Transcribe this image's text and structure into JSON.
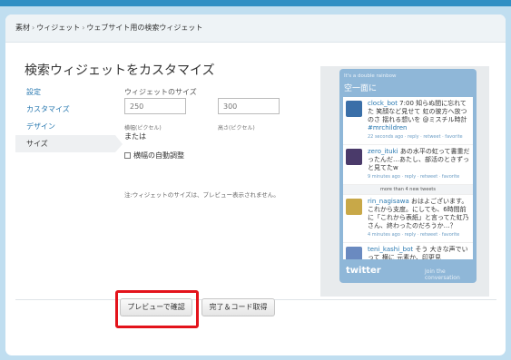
{
  "breadcrumb": [
    "素材",
    "ウィジェット",
    "ウェブサイト用の検索ウィジェット"
  ],
  "page_title": "検索ウィジェットをカスタマイズ",
  "nav": [
    {
      "label": "設定",
      "active": false
    },
    {
      "label": "カスタマイズ",
      "active": false
    },
    {
      "label": "デザイン",
      "active": false
    },
    {
      "label": "サイズ",
      "active": true
    }
  ],
  "form": {
    "size_label": "ウィジェットのサイズ",
    "width_placeholder": "250",
    "height_placeholder": "300",
    "width_hint": "横幅(ピクセル)",
    "height_hint": "高さ(ピクセル)",
    "or_label": "または",
    "auto_width_label": "横幅の自動調整",
    "note": "注:ウィジェットのサイズは、プレビュー表示されません。"
  },
  "widget": {
    "subtitle": "It's a double rainbow",
    "title": "空一面に",
    "tweets": [
      {
        "user": "clock_bot",
        "text_before": " 7:00 知らぬ間に忘れてた 笑顔など見せて 虹の彼方へ放つのさ 揺れる想いを @ミスチル時計 ",
        "link": "#mrchildren",
        "meta": "22 seconds ago · reply · retweet · favorite",
        "avatar_color": "#3a6fa8"
      },
      {
        "user": "zero_ituki",
        "text_before": " あの水平の虹って書重だったんだ…あたし、部活のときずっと見てたw",
        "link": "",
        "meta": "9 minutes ago · reply · retweet · favorite",
        "avatar_color": "#4a3a6a"
      },
      {
        "user": "rin_nagisawa",
        "text_before": " おはよございます。これから支度。にしても、6時間前に「これから表紙」と言ってた虹乃さん、終わったのだろうか…？",
        "link": "",
        "meta": "4 minutes ago · reply · retweet · favorite",
        "avatar_color": "#c8a848"
      },
      {
        "user": "teni_kashi_bot",
        "text_before": " そう 大きな声でいって 横に 元素か、印更見",
        "link": "",
        "meta": "",
        "avatar_color": "#6a8ac0"
      }
    ],
    "more_label": "more than 4 new tweets",
    "logo": "twitter",
    "join_label": "Join the conversation"
  },
  "buttons": {
    "preview": "プレビューで確認",
    "done": "完了＆コード取得"
  },
  "colors": {
    "accent_link": "#2878b0",
    "highlight": "#e3131b",
    "widget_frame": "#8fb7d8"
  }
}
